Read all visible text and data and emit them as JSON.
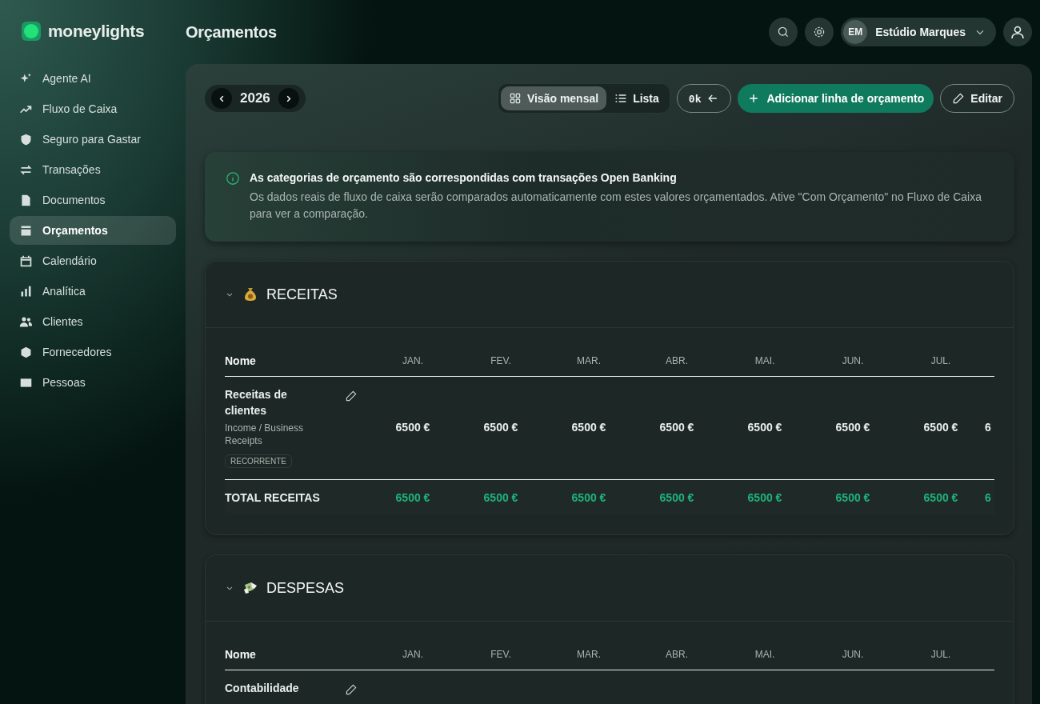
{
  "brand": {
    "name": "moneylights"
  },
  "page_title": "Orçamentos",
  "sidebar": {
    "items": [
      {
        "label": "Agente AI",
        "selected": false
      },
      {
        "label": "Fluxo de Caixa",
        "selected": false
      },
      {
        "label": "Seguro para Gastar",
        "selected": false
      },
      {
        "label": "Transações",
        "selected": false
      },
      {
        "label": "Documentos",
        "selected": false
      },
      {
        "label": "Orçamentos",
        "selected": true
      },
      {
        "label": "Calendário",
        "selected": false
      },
      {
        "label": "Analítica",
        "selected": false
      },
      {
        "label": "Clientes",
        "selected": false
      },
      {
        "label": "Fornecedores",
        "selected": false
      },
      {
        "label": "Pessoas",
        "selected": false
      }
    ]
  },
  "header": {
    "account": {
      "initials": "EM",
      "name": "Estúdio Marques"
    }
  },
  "toolbar": {
    "year": "2026",
    "views": [
      {
        "label": "Visão mensal",
        "selected": true
      },
      {
        "label": "Lista",
        "selected": false
      }
    ],
    "scale_button": "0k",
    "add_button": "Adicionar linha de orçamento",
    "edit_button": "Editar"
  },
  "info": {
    "title": "As categorias de orçamento são correspondidas com transações Open Banking",
    "text": "Os dados reais de fluxo de caixa serão comparados automaticamente com estes valores orçamentados. Ative \"Com Orçamento\" no Fluxo de Caixa para ver a comparação."
  },
  "sections": [
    {
      "title": "RECEITAS",
      "kind": "income",
      "expanded": true,
      "columns": [
        "Nome",
        "JAN.",
        "FEV.",
        "MAR.",
        "ABR.",
        "MAI.",
        "JUN.",
        "JUL."
      ],
      "rows": [
        {
          "name": "Receitas de clientes",
          "category": "Income / Business Receipts",
          "tag": "RECORRENTE",
          "values": [
            "6500 €",
            "6500 €",
            "6500 €",
            "6500 €",
            "6500 €",
            "6500 €",
            "6500 €",
            "6"
          ]
        }
      ],
      "total": {
        "label": "TOTAL RECEITAS",
        "values": [
          "6500 €",
          "6500 €",
          "6500 €",
          "6500 €",
          "6500 €",
          "6500 €",
          "6500 €",
          "6"
        ]
      }
    },
    {
      "title": "DESPESAS",
      "kind": "expense",
      "expanded": true,
      "columns": [
        "Nome",
        "JAN.",
        "FEV.",
        "MAR.",
        "ABR.",
        "MAI.",
        "JUN.",
        "JUL."
      ],
      "rows": [
        {
          "name": "Contabilidade"
        }
      ]
    }
  ]
}
